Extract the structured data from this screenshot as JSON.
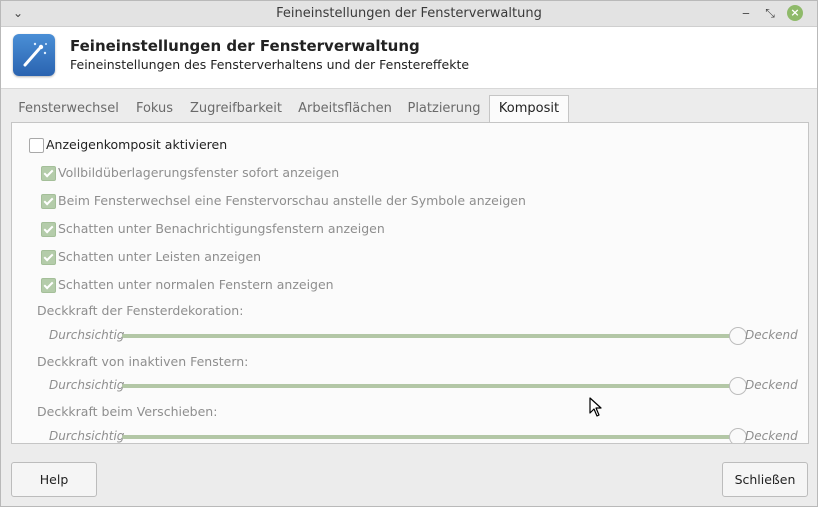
{
  "window": {
    "title": "Feineinstellungen der Fensterverwaltung"
  },
  "header": {
    "title": "Feineinstellungen der Fensterverwaltung",
    "subtitle": "Feineinstellungen des Fensterverhaltens und der Fenstereffekte"
  },
  "tabs": [
    {
      "label": "Fensterwechsel"
    },
    {
      "label": "Fokus"
    },
    {
      "label": "Zugreifbarkeit"
    },
    {
      "label": "Arbeitsflächen"
    },
    {
      "label": "Platzierung"
    },
    {
      "label": "Komposit",
      "active": true
    }
  ],
  "composit": {
    "enable_label": "Anzeigenkomposit aktivieren",
    "enable_checked": false,
    "options": [
      {
        "label": "Vollbildüberlagerungsfenster sofort anzeigen",
        "checked": true
      },
      {
        "label": "Beim Fensterwechsel eine Fenstervorschau anstelle der Symbole anzeigen",
        "checked": true
      },
      {
        "label": "Schatten unter Benachrichtigungsfenstern anzeigen",
        "checked": true
      },
      {
        "label": "Schatten unter Leisten anzeigen",
        "checked": true
      },
      {
        "label": "Schatten unter normalen Fenstern anzeigen",
        "checked": true
      }
    ],
    "sliders": [
      {
        "label": "Deckkraft der Fensterdekoration:",
        "min_label": "Durchsichtig",
        "max_label": "Deckend",
        "value": 1.0
      },
      {
        "label": "Deckkraft von inaktiven Fenstern:",
        "min_label": "Durchsichtig",
        "max_label": "Deckend",
        "value": 1.0
      },
      {
        "label": "Deckkraft beim Verschieben:",
        "min_label": "Durchsichtig",
        "max_label": "Deckend",
        "value": 1.0
      }
    ]
  },
  "buttons": {
    "help": "Help",
    "close": "Schließen"
  },
  "colors": {
    "accent": "#b4ccaa",
    "close_button": "#8fba6a"
  }
}
